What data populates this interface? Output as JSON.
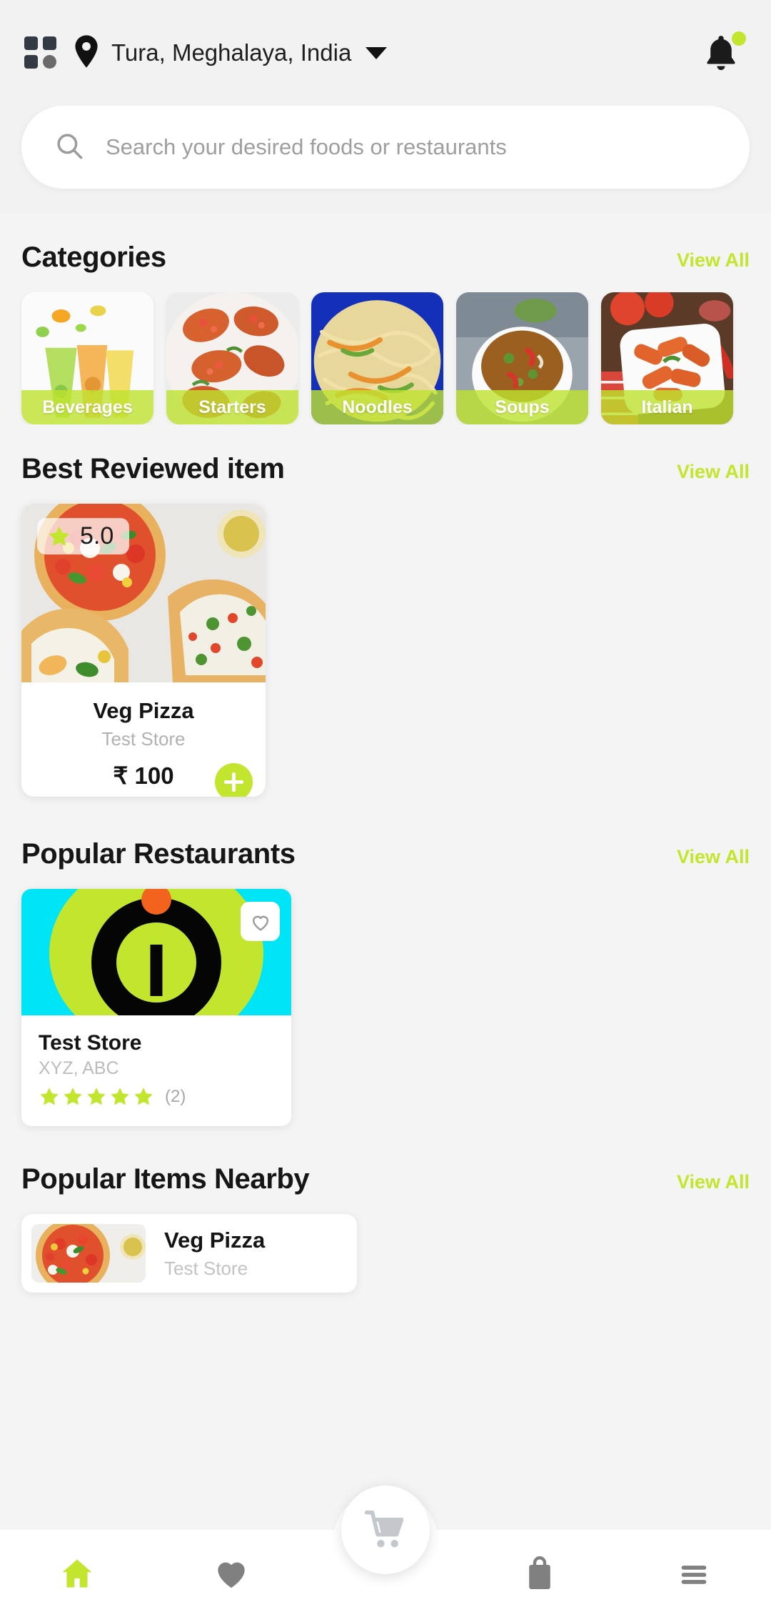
{
  "header": {
    "grid_icon": "grid-menu-icon",
    "location_icon": "location-pin-icon",
    "location": "Tura, Meghalaya, India",
    "dropdown_icon": "chevron-down-icon",
    "notification_icon": "bell-icon",
    "notification_dot": true
  },
  "search": {
    "icon": "search-icon",
    "placeholder": "Search your desired foods or restaurants",
    "value": ""
  },
  "colors": {
    "accent": "#c2e62e",
    "background": "#f4f4f4",
    "card": "#ffffff",
    "muted_text": "#b2b2b2",
    "banner_cyan": "#00e5f5",
    "banner_orange": "#f2641e"
  },
  "sections": [
    {
      "title": "Categories",
      "view_all": "View All"
    },
    {
      "title": "Best Reviewed item",
      "view_all": "View All"
    },
    {
      "title": "Popular Restaurants",
      "view_all": "View All"
    },
    {
      "title": "Popular Items Nearby",
      "view_all": "View All"
    }
  ],
  "categories": [
    {
      "label": "Beverages"
    },
    {
      "label": "Starters"
    },
    {
      "label": "Noodles"
    },
    {
      "label": "Soups"
    },
    {
      "label": "Italian"
    }
  ],
  "best_reviewed": {
    "rating": "5.0",
    "star_icon": "star-icon",
    "name": "Veg Pizza",
    "store": "Test Store",
    "price": "₹ 100",
    "add_icon": "plus-icon"
  },
  "popular_restaurant": {
    "name": "Test Store",
    "address": "XYZ, ABC",
    "stars": 5,
    "review_count": "(2)",
    "favorite_icon": "heart-outline-icon"
  },
  "popular_nearby": {
    "name": "Veg Pizza",
    "store": "Test Store"
  },
  "bottom_nav": {
    "cart_icon": "shopping-cart-icon",
    "items": [
      {
        "icon": "home-icon",
        "active": true
      },
      {
        "icon": "heart-icon",
        "active": false
      },
      {
        "icon": "bag-icon",
        "active": false
      },
      {
        "icon": "hamburger-menu-icon",
        "active": false
      }
    ]
  }
}
